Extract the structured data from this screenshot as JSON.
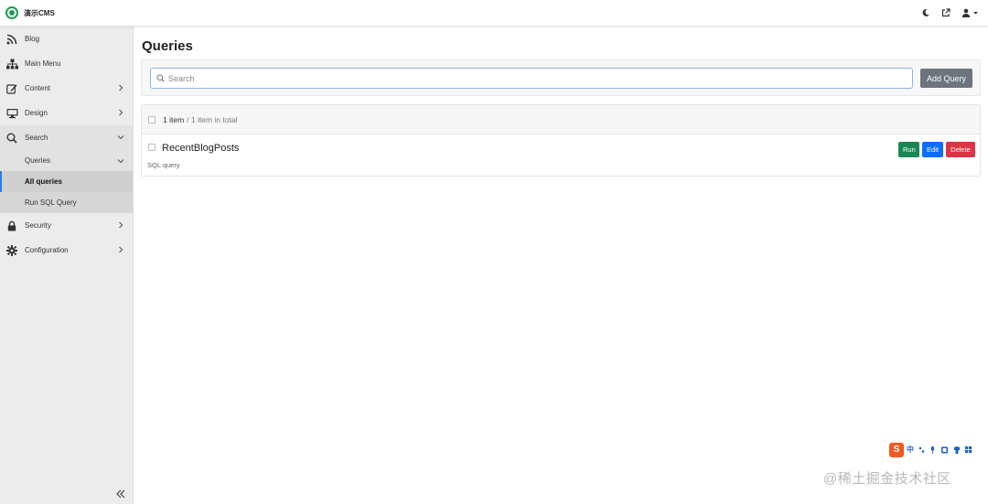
{
  "app": {
    "name": "演示CMS"
  },
  "topbar": {
    "icons": [
      "moon-icon",
      "external-link-icon",
      "user-icon",
      "caret-down-icon"
    ]
  },
  "sidebar": {
    "items": [
      {
        "label": "Blog",
        "icon": "rss-icon"
      },
      {
        "label": "Main Menu",
        "icon": "sitemap-icon"
      },
      {
        "label": "Content",
        "icon": "edit-icon"
      },
      {
        "label": "Design",
        "icon": "monitor-icon"
      },
      {
        "label": "Search",
        "icon": "search-icon"
      },
      {
        "label": "Security",
        "icon": "lock-icon"
      },
      {
        "label": "Configuration",
        "icon": "gear-icon"
      }
    ],
    "search_children": {
      "queries": "Queries",
      "all_queries": "All queries",
      "run_sql": "Run SQL Query"
    }
  },
  "main": {
    "title": "Queries",
    "search": {
      "placeholder": "Search",
      "value": ""
    },
    "add_button": "Add Query",
    "list": {
      "count": "1 item",
      "total": "/ 1 item in total",
      "rows": [
        {
          "title": "RecentBlogPosts",
          "subtitle": "SQL query"
        }
      ],
      "actions": {
        "run": "Run",
        "edit": "Edit",
        "delete": "Delete"
      }
    }
  },
  "overlay": {
    "ime": {
      "logo": "S",
      "lang": "中"
    },
    "watermark": "@稀土掘金技术社区"
  },
  "colors": {
    "accent": "#2f7be8",
    "run": "#198754",
    "edit": "#0d6efd",
    "delete": "#dc3545",
    "add": "#6c757d",
    "brand": "#1e9c54"
  }
}
